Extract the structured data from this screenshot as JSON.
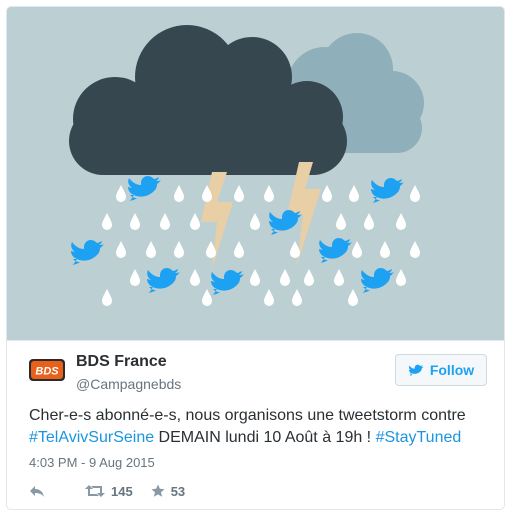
{
  "tweet": {
    "display_name": "BDS France",
    "handle": "@Campagnebds",
    "avatar_text": "BDS",
    "follow_label": "Follow",
    "text_part1": "Cher-e-s abonné-e-s, nous organisons une tweetstorm contre ",
    "hashtag1": "#TelAvivSurSeine",
    "text_part2": " DEMAIN lundi 10 Août à 19h ! ",
    "hashtag2": "#StayTuned",
    "timestamp": "4:03 PM - 9 Aug 2015",
    "retweet_count": "145",
    "like_count": "53"
  },
  "colors": {
    "accent": "#1da1f2",
    "link": "#1b95e0",
    "media_background": "#bccfd3",
    "cloud_dark": "#37474f",
    "cloud_light": "#8fb0ba",
    "drop": "#ffffff",
    "lightning": "#e8cfa6",
    "avatar_orange": "#e8611a"
  },
  "icons": [
    "reply-icon",
    "retweet-icon",
    "star-icon",
    "twitter-bird-icon"
  ]
}
